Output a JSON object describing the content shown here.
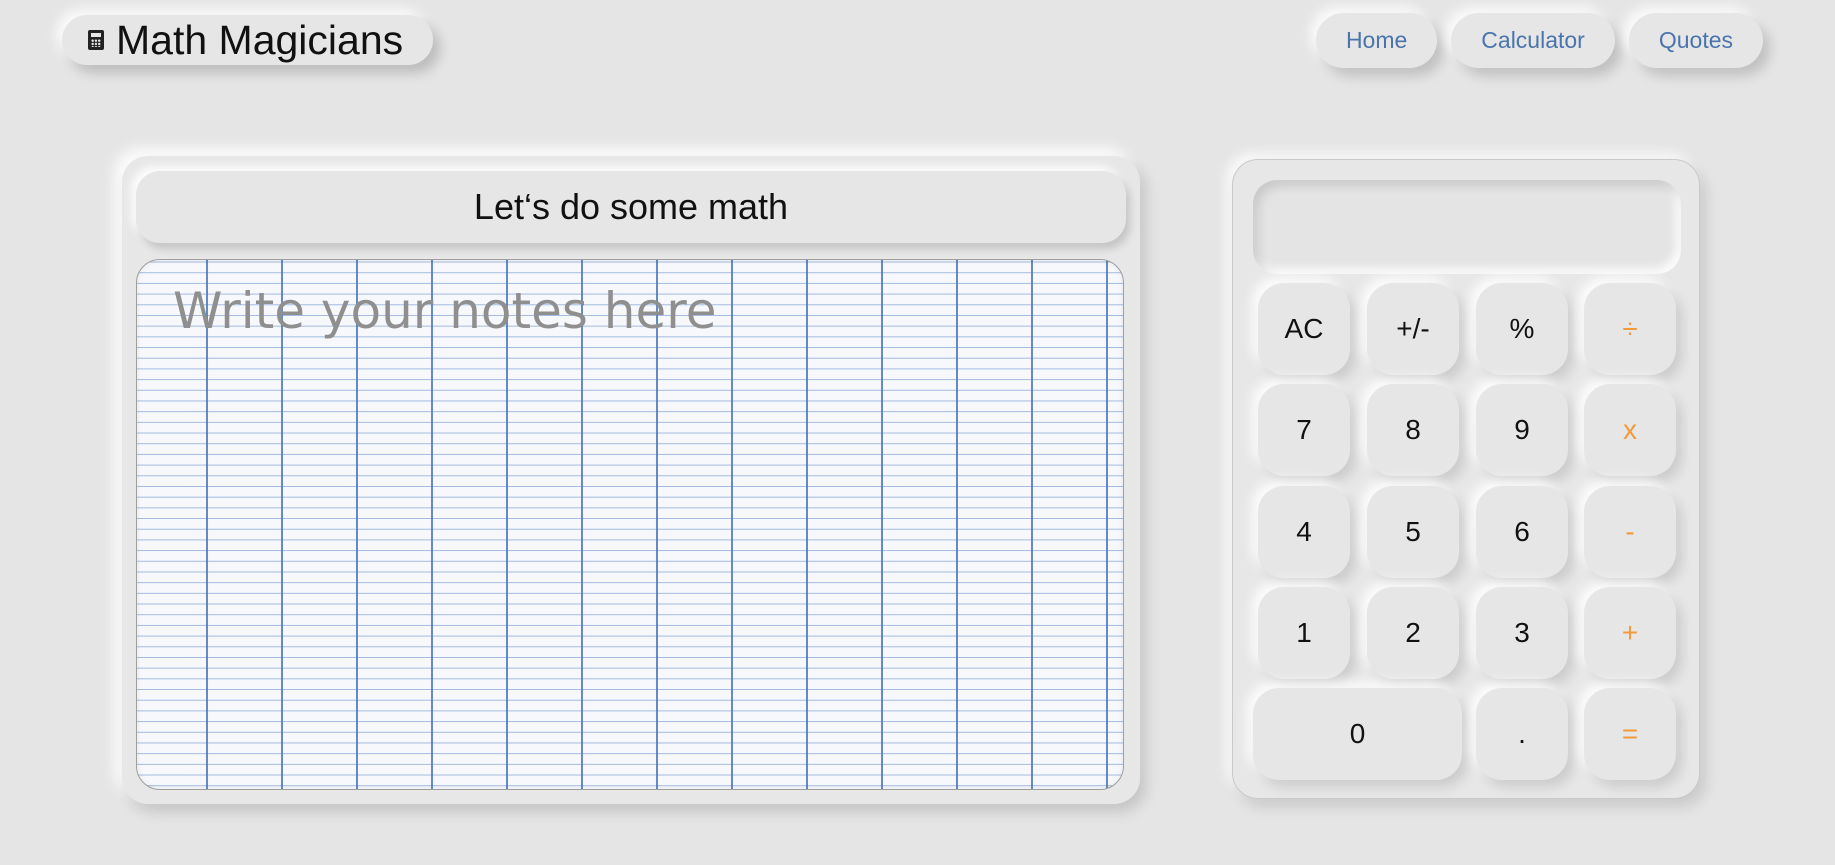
{
  "header": {
    "title": "Math Magicians",
    "icon": "calculator-icon",
    "nav": [
      {
        "label": "Home"
      },
      {
        "label": "Calculator"
      },
      {
        "label": "Quotes"
      }
    ]
  },
  "notes": {
    "heading": "Let‘s do some math",
    "placeholder": "Write your notes here"
  },
  "calculator": {
    "display": "",
    "keys": {
      "ac": "AC",
      "sign": "+/-",
      "percent": "%",
      "divide": "÷",
      "seven": "7",
      "eight": "8",
      "nine": "9",
      "multiply": "x",
      "four": "4",
      "five": "5",
      "six": "6",
      "minus": "-",
      "one": "1",
      "two": "2",
      "three": "3",
      "plus": "+",
      "zero": "0",
      "dot": ".",
      "equals": "="
    }
  },
  "colors": {
    "background": "#e5e5e5",
    "nav_text": "#4a74ad",
    "operator_accent": "#f39a3b",
    "grid_line": "#4678c3"
  }
}
